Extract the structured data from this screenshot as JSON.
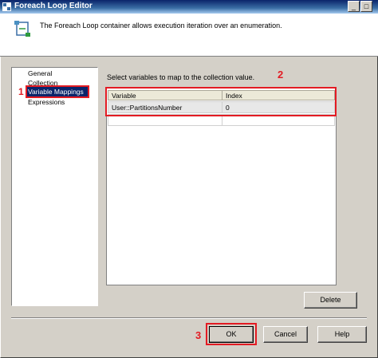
{
  "window": {
    "title": "Foreach Loop Editor",
    "minimize_label": "_",
    "maximize_label": "□"
  },
  "header": {
    "description": "The Foreach Loop container allows execution iteration over an enumeration."
  },
  "nav": {
    "items": [
      {
        "label": "General"
      },
      {
        "label": "Collection"
      },
      {
        "label": "Variable Mappings",
        "selected": true
      },
      {
        "label": "Expressions"
      }
    ]
  },
  "main": {
    "instruction": "Select variables to map to the collection value.",
    "grid": {
      "columns": [
        "Variable",
        "Index"
      ],
      "rows": [
        [
          "User::PartitionsNumber",
          "0"
        ],
        [
          "",
          ""
        ]
      ]
    },
    "delete_label": "Delete"
  },
  "footer": {
    "ok_label": "OK",
    "cancel_label": "Cancel",
    "help_label": "Help"
  },
  "annotations": {
    "label1": "1",
    "label2": "2",
    "label3": "3",
    "color": "#e31b23"
  },
  "colors": {
    "selection": "#0a246a",
    "face": "#d4d0c8"
  }
}
